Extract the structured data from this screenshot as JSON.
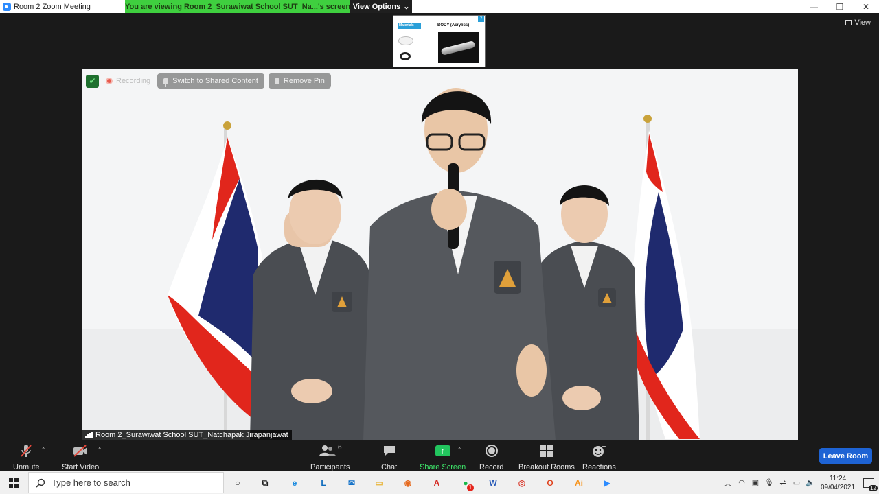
{
  "window": {
    "title": "Room 2   Zoom Meeting",
    "controls": {
      "minimize": "—",
      "restore": "❐",
      "close": "✕"
    }
  },
  "banner": {
    "viewing_text": "You are viewing Room 2_Surawiwat School SUT_Na...'s screen",
    "view_options_label": "View Options",
    "view_options_caret": "⌄"
  },
  "shared_thumbnail": {
    "page_number": "7",
    "materials_label": "Materials",
    "body_title": "BODY (Acrylics)"
  },
  "view_button": {
    "label": "View"
  },
  "video_overlay": {
    "recording_label": "Recording",
    "switch_to_shared_label": "Switch to Shared Content",
    "remove_pin_label": "Remove Pin",
    "participant_name": "Room 2_Surawiwat School SUT_Natchapak Jirapanjawat"
  },
  "toolbar": {
    "unmute_label": "Unmute",
    "start_video_label": "Start Video",
    "participants_label": "Participants",
    "participants_count": "6",
    "chat_label": "Chat",
    "share_screen_label": "Share Screen",
    "record_label": "Record",
    "breakout_rooms_label": "Breakout Rooms",
    "reactions_label": "Reactions",
    "leave_room_label": "Leave Room",
    "caret": "^"
  },
  "taskbar": {
    "search_placeholder": "Type here to search",
    "apps": [
      {
        "name": "cortana-icon",
        "glyph": "○",
        "color": "#222222"
      },
      {
        "name": "task-view-icon",
        "glyph": "⧉",
        "color": "#222222"
      },
      {
        "name": "edge-icon",
        "glyph": "e",
        "color": "#1a8adf"
      },
      {
        "name": "learning-app-icon",
        "glyph": "L",
        "color": "#0f6cbd"
      },
      {
        "name": "mail-icon",
        "glyph": "✉",
        "color": "#1070c8"
      },
      {
        "name": "file-explorer-icon",
        "glyph": "▭",
        "color": "#e8b53a"
      },
      {
        "name": "firefox-icon",
        "glyph": "◉",
        "color": "#e66a1e"
      },
      {
        "name": "acrobat-icon",
        "glyph": "A",
        "color": "#d4261f"
      },
      {
        "name": "line-icon",
        "glyph": "●",
        "color": "#18b94a"
      },
      {
        "name": "word-icon",
        "glyph": "W",
        "color": "#2b5cb8"
      },
      {
        "name": "chrome-icon",
        "glyph": "◎",
        "color": "#db4437"
      },
      {
        "name": "office-icon",
        "glyph": "O",
        "color": "#e0431e"
      },
      {
        "name": "illustrator-icon",
        "glyph": "Ai",
        "color": "#f7941d"
      },
      {
        "name": "zoom-icon",
        "glyph": "▶",
        "color": "#2d8cff"
      }
    ],
    "line_badge": "1",
    "time": "11:24",
    "date": "09/04/2021",
    "notification_count": "12",
    "tray_icons": [
      {
        "name": "chevron-up-icon",
        "glyph": "︿"
      },
      {
        "name": "network-icon",
        "glyph": "◠"
      },
      {
        "name": "meet-now-icon",
        "glyph": "▣"
      },
      {
        "name": "microphone-icon",
        "glyph": "🎙"
      },
      {
        "name": "usb-icon",
        "glyph": "⇌"
      },
      {
        "name": "battery-icon",
        "glyph": "▭"
      },
      {
        "name": "volume-icon",
        "glyph": "🔈"
      }
    ]
  },
  "colors": {
    "banner_green": "#3fcf3f",
    "share_green": "#22c55e",
    "leave_blue": "#1e63d4",
    "toolbar_bg": "#1a1a1a",
    "flag_red": "#e1261c",
    "flag_blue": "#1f2a6e",
    "suit_gray": "#4a4d52"
  }
}
